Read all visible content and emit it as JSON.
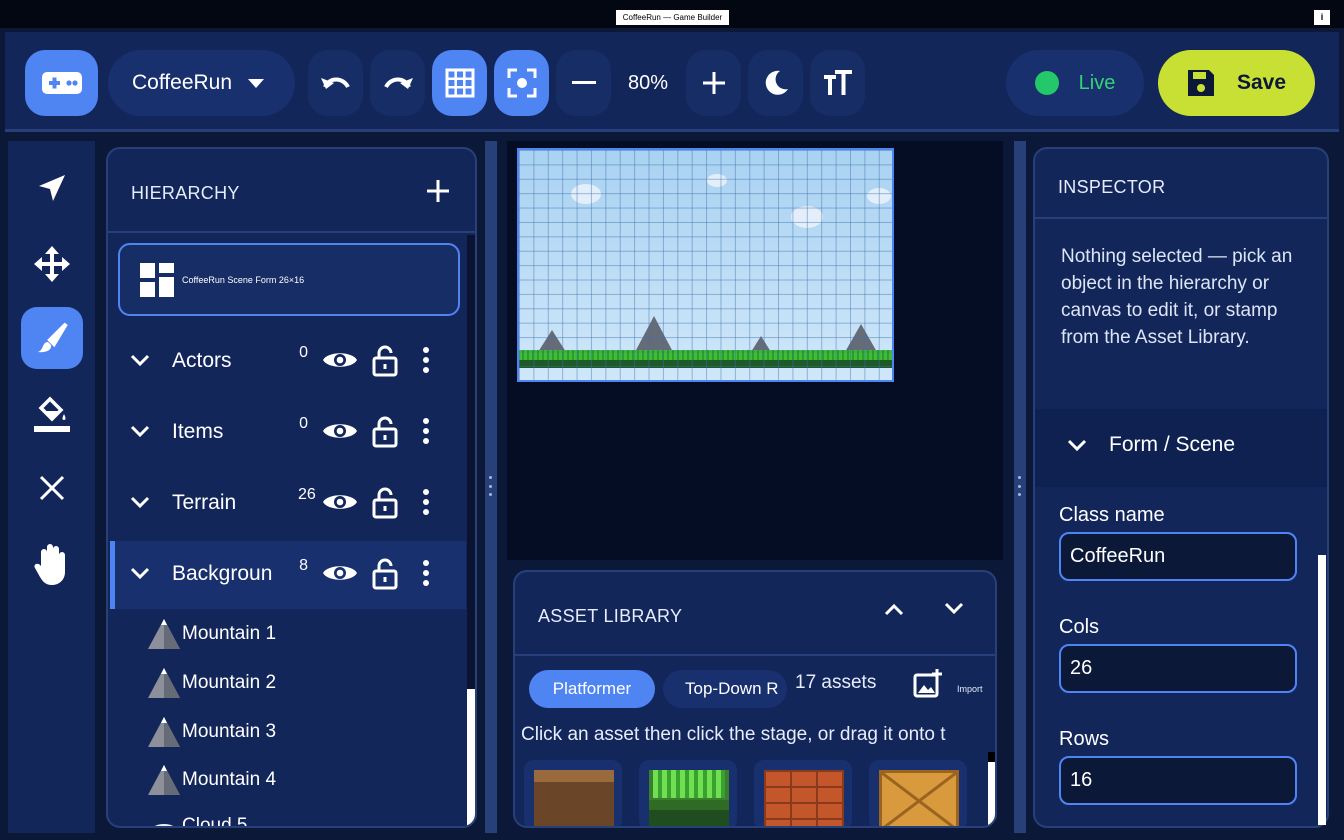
{
  "window": {
    "title": "CoffeeRun — Game Builder",
    "info_label": "i"
  },
  "toolbar": {
    "project_name": "CoffeeRun",
    "zoom_level": "80%",
    "live_label": "Live",
    "save_label": "Save",
    "accent_color": "#4f85f3",
    "save_color": "#c8e034",
    "live_color": "#23c86a",
    "icons": [
      "gamepad-icon",
      "undo-icon",
      "redo-icon",
      "grid-icon",
      "focus-icon",
      "zoom-out-icon",
      "zoom-in-icon",
      "moon-icon",
      "text-size-icon",
      "floppy-icon"
    ]
  },
  "tools": [
    "select-arrow-icon",
    "move-icon",
    "brush-icon",
    "fill-bucket-icon",
    "erase-x-icon",
    "pan-hand-icon"
  ],
  "active_tool": "brush-icon",
  "hierarchy": {
    "title": "HIERARCHY",
    "scene_label": "CoffeeRun Scene   Form 26×16",
    "layers": [
      {
        "name": "Actors",
        "count": "0"
      },
      {
        "name": "Items",
        "count": "0"
      },
      {
        "name": "Terrain",
        "count": "26"
      },
      {
        "name": "Backgroun",
        "count": "8"
      }
    ],
    "objects": [
      "Mountain 1",
      "Mountain 2",
      "Mountain 3",
      "Mountain 4",
      "Cloud 5"
    ]
  },
  "asset_library": {
    "title": "ASSET LIBRARY",
    "tabs": [
      "Platformer",
      "Top-Down R"
    ],
    "count_label": "17 assets",
    "import_label": "Import",
    "hint": "Click an asset then click the stage, or drag it onto t",
    "tiles": [
      "dirt-tile",
      "grass-tile",
      "brick-tile",
      "crate-tile"
    ]
  },
  "inspector": {
    "title": "INSPECTOR",
    "empty_text": "Nothing selected — pick an object in the hierarchy or canvas to edit it, or stamp from the Asset Library.",
    "section_title": "Form / Scene",
    "fields": [
      {
        "label": "Class name",
        "value": "CoffeeRun"
      },
      {
        "label": "Cols",
        "value": "26"
      },
      {
        "label": "Rows",
        "value": "16"
      }
    ]
  }
}
